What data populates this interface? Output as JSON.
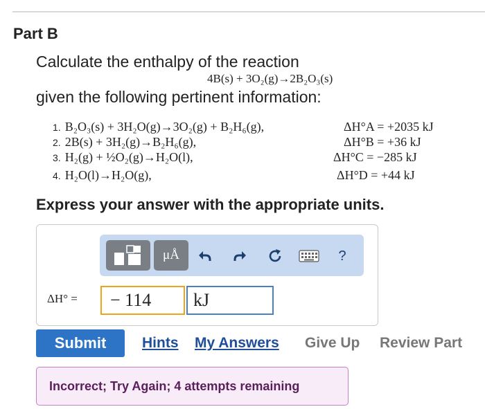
{
  "part_title": "Part B",
  "question": {
    "line1": "Calculate the enthalpy of the reaction",
    "reaction": "4B(s) + 3O₂(g)→2B₂O₃(s)",
    "line2": "given the following pertinent information:"
  },
  "steps": [
    {
      "num": "1.",
      "equation": "B₂O₃(s) + 3H₂O(g)→3O₂(g) + B₂H₆(g),",
      "dh": "ΔH°A = +2035 kJ"
    },
    {
      "num": "2.",
      "equation": "2B(s) + 3H₂(g)→B₂H₆(g),",
      "dh": "ΔH°B = +36 kJ"
    },
    {
      "num": "3.",
      "equation": "H₂(g) + ½O₂(g)→H₂O(l),",
      "dh": "ΔH°C = −285 kJ"
    },
    {
      "num": "4.",
      "equation": "H₂O(l)→H₂O(g),",
      "dh": "ΔH°D = +44 kJ"
    }
  ],
  "instruction": "Express your answer with the appropriate units.",
  "toolbar": {
    "mu_label": "μÅ",
    "help_label": "?"
  },
  "answer": {
    "label": "ΔH° =",
    "value": "− 114",
    "unit": "kJ"
  },
  "actions": {
    "submit": "Submit",
    "hints": "Hints",
    "my_answers": "My Answers",
    "give_up": "Give Up",
    "review_part": "Review Part"
  },
  "feedback": "Incorrect; Try Again; 4 attempts remaining",
  "colors": {
    "submit_bg": "#2d74c6",
    "toolbar_bg": "#c6d9f0",
    "feedback_border": "#c77cc7",
    "value_border": "#f0a21a",
    "unit_border": "#4a7fc1"
  },
  "icons": [
    "templates-icon",
    "undo-icon",
    "redo-icon",
    "reset-icon",
    "keyboard-icon"
  ]
}
